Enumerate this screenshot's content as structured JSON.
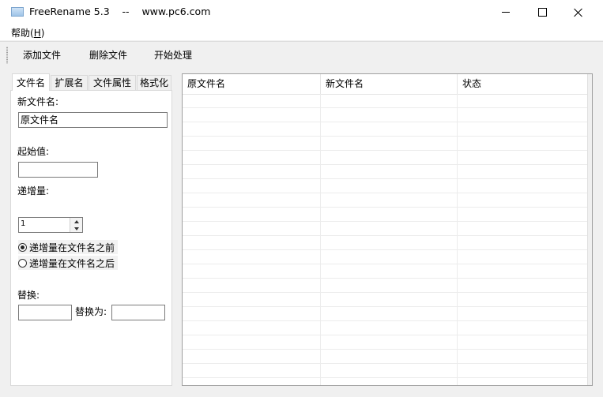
{
  "window": {
    "title": "FreeRename 5.3    --    www.pc6.com"
  },
  "menu": {
    "help_label": "帮助(",
    "help_key": "H",
    "help_close": ")"
  },
  "toolbar": {
    "add_file": "添加文件",
    "delete_file": "删除文件",
    "start_process": "开始处理"
  },
  "tabs": [
    {
      "label": "文件名"
    },
    {
      "label": "扩展名"
    },
    {
      "label": "文件属性"
    },
    {
      "label": "格式化"
    }
  ],
  "filename_tab": {
    "new_name_label": "新文件名:",
    "new_name_value": "原文件名",
    "start_label": "起始值:",
    "start_value": "",
    "increment_label": "递增量:",
    "increment_value": "1",
    "radio_before": "递增量在文件名之前",
    "radio_after": "递增量在文件名之后",
    "radio_selected": "before",
    "replace_label": "替换:",
    "replace_value": "",
    "replace_with_label": "替换为:",
    "replace_with_value": ""
  },
  "list": {
    "columns": [
      "原文件名",
      "新文件名",
      "状态"
    ]
  }
}
